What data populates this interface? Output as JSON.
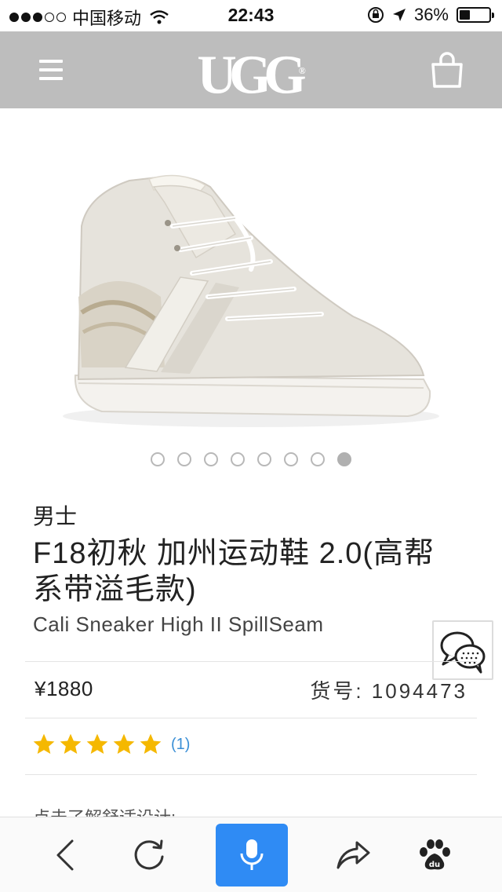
{
  "status_bar": {
    "carrier": "中国移动",
    "time": "22:43",
    "battery": "36%",
    "battery_level": 0.36,
    "signal_strength": 3,
    "signal_max": 5
  },
  "header": {
    "logo_text": "UGG",
    "menu_icon": "hamburger-menu-icon",
    "bag_icon": "shopping-bag-icon",
    "background_color": "#bdbdbd"
  },
  "product": {
    "image_description_icon": "sneaker-image",
    "carousel": {
      "total_slides": 8,
      "active_slide": 8
    },
    "gender": "男士",
    "title": "F18初秋 加州运动鞋 2.0(高帮系带溢毛款)",
    "subtitle": "Cali Sneaker High II SpillSeam",
    "price": "¥1880",
    "sku": "货号: 1094473",
    "rating": 5,
    "rating_max": 5,
    "review_count": "(1)",
    "teaser": "点击了解舒适设计:"
  },
  "colors": {
    "star": "#f5b800",
    "link": "#3a8fd6",
    "mic_button": "#2f8bf4"
  },
  "toolbar": {
    "back_icon": "back-arrow-icon",
    "refresh_icon": "refresh-icon",
    "voice_icon": "microphone-icon",
    "share_icon": "share-icon",
    "baidu_icon": "baidu-paw-icon"
  }
}
